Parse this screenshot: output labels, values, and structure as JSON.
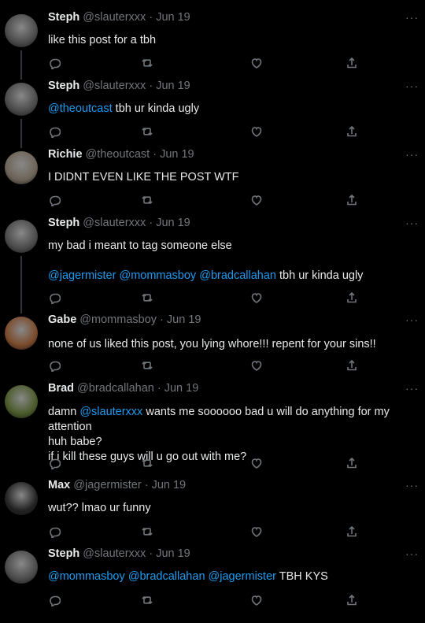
{
  "tweets": [
    {
      "name": "Steph",
      "handle": "@slauterxxx",
      "dot": "·",
      "date": "Jun 19",
      "segments": [
        [
          {
            "t": "like this post for a tbh"
          }
        ]
      ],
      "avatar_color": "#4a4a4a"
    },
    {
      "name": "Steph",
      "handle": "@slauterxxx",
      "dot": "·",
      "date": "Jun 19",
      "segments": [
        [
          {
            "t": "@theoutcast",
            "m": true
          },
          {
            "t": " tbh ur kinda ugly"
          }
        ]
      ],
      "avatar_color": "#4a4a4a"
    },
    {
      "name": "Richie",
      "handle": "@theoutcast",
      "dot": "·",
      "date": "Jun 19",
      "segments": [
        [
          {
            "t": "I DIDNT EVEN LIKE THE POST WTF"
          }
        ]
      ],
      "avatar_color": "#6d6458"
    },
    {
      "name": "Steph",
      "handle": "@slauterxxx",
      "dot": "·",
      "date": "Jun 19",
      "segments": [
        [
          {
            "t": "my bad i meant to tag someone else"
          }
        ],
        [
          {
            "t": ""
          }
        ],
        [
          {
            "t": "@jagermister",
            "m": true
          },
          {
            "t": " "
          },
          {
            "t": "@mommasboy",
            "m": true
          },
          {
            "t": " "
          },
          {
            "t": "@bradcallahan",
            "m": true
          },
          {
            "t": " tbh ur kinda ugly"
          }
        ]
      ],
      "avatar_color": "#4a4a4a"
    },
    {
      "name": "Gabe",
      "handle": "@mommasboy",
      "dot": "·",
      "date": "Jun 19",
      "segments": [
        [
          {
            "t": "none of us liked this post, you lying whore!!! repent for your sins!!"
          }
        ]
      ],
      "avatar_color": "#7a4a2a"
    },
    {
      "name": "Brad",
      "handle": "@bradcallahan",
      "dot": "·",
      "date": "Jun 19",
      "segments": [
        [
          {
            "t": "damn "
          },
          {
            "t": "@slauterxxx",
            "m": true
          },
          {
            "t": " wants me soooooo bad u will do anything for my attention"
          }
        ],
        [
          {
            "t": "huh babe?"
          }
        ],
        [
          {
            "t": "if i kill these guys will u go out with me?"
          }
        ]
      ],
      "avatar_color": "#4a5a2a"
    },
    {
      "name": "Max",
      "handle": "@jagermister",
      "dot": "·",
      "date": "Jun 19",
      "segments": [
        [
          {
            "t": "wut?? lmao ur funny"
          }
        ]
      ],
      "avatar_color": "#222222"
    },
    {
      "name": "Steph",
      "handle": "@slauterxxx",
      "dot": "·",
      "date": "Jun 19",
      "segments": [
        [
          {
            "t": "@mommasboy",
            "m": true
          },
          {
            "t": " "
          },
          {
            "t": "@bradcallahan",
            "m": true
          },
          {
            "t": " "
          },
          {
            "t": "@jagermister",
            "m": true
          },
          {
            "t": " TBH KYS"
          }
        ]
      ],
      "avatar_color": "#4a4a4a"
    }
  ],
  "more_label": "···",
  "icons": [
    "reply-icon",
    "retweet-icon",
    "like-icon",
    "share-icon"
  ]
}
